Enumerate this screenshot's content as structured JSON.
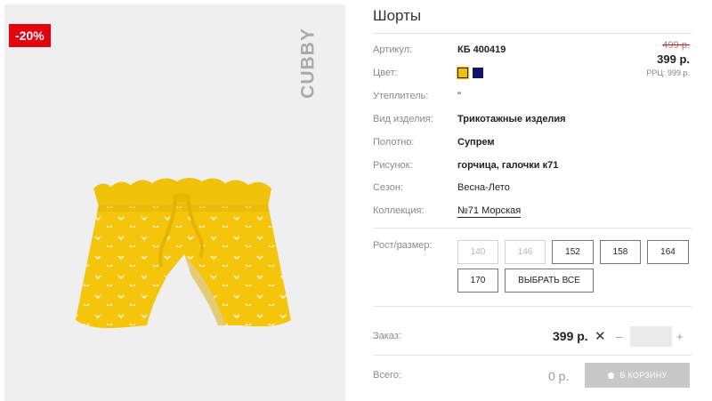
{
  "product": {
    "title": "Шорты",
    "discount_badge": "-20%",
    "brand": "CUBBY",
    "image_alt": "Шорты",
    "old_price": "499 р.",
    "price": "399 р.",
    "rrp": "РРЦ: 999 р."
  },
  "attributes": [
    {
      "label": "Артикул:",
      "value": "КБ 400419"
    },
    {
      "label": "Цвет:",
      "value": ""
    },
    {
      "label": "Утеплитель:",
      "value": "\""
    },
    {
      "label": "Вид изделия:",
      "value": "Трикотажные изделия"
    },
    {
      "label": "Полотно:",
      "value": "Супрем"
    },
    {
      "label": "Рисунок:",
      "value": "горчица, галочки к71"
    },
    {
      "label": "Сезон:",
      "value": "Весна-Лето"
    },
    {
      "label": "Коллекция:",
      "value": "№71 Морская"
    }
  ],
  "colors": [
    "#f2c200",
    "#15146b"
  ],
  "sizes": {
    "label": "Рост/размер:",
    "options": [
      {
        "label": "140",
        "available": false
      },
      {
        "label": "146",
        "available": false
      },
      {
        "label": "152",
        "available": true
      },
      {
        "label": "158",
        "available": true
      },
      {
        "label": "164",
        "available": true
      },
      {
        "label": "170",
        "available": true
      }
    ],
    "select_all": "ВЫБРАТЬ ВСЕ"
  },
  "order": {
    "label": "Заказ:",
    "price": "399 р.",
    "times": "✕",
    "minus": "–",
    "plus": "+",
    "quantity": ""
  },
  "total": {
    "label": "Всего:",
    "value": "0 р.",
    "cart_button": "В КОРЗИНУ"
  }
}
